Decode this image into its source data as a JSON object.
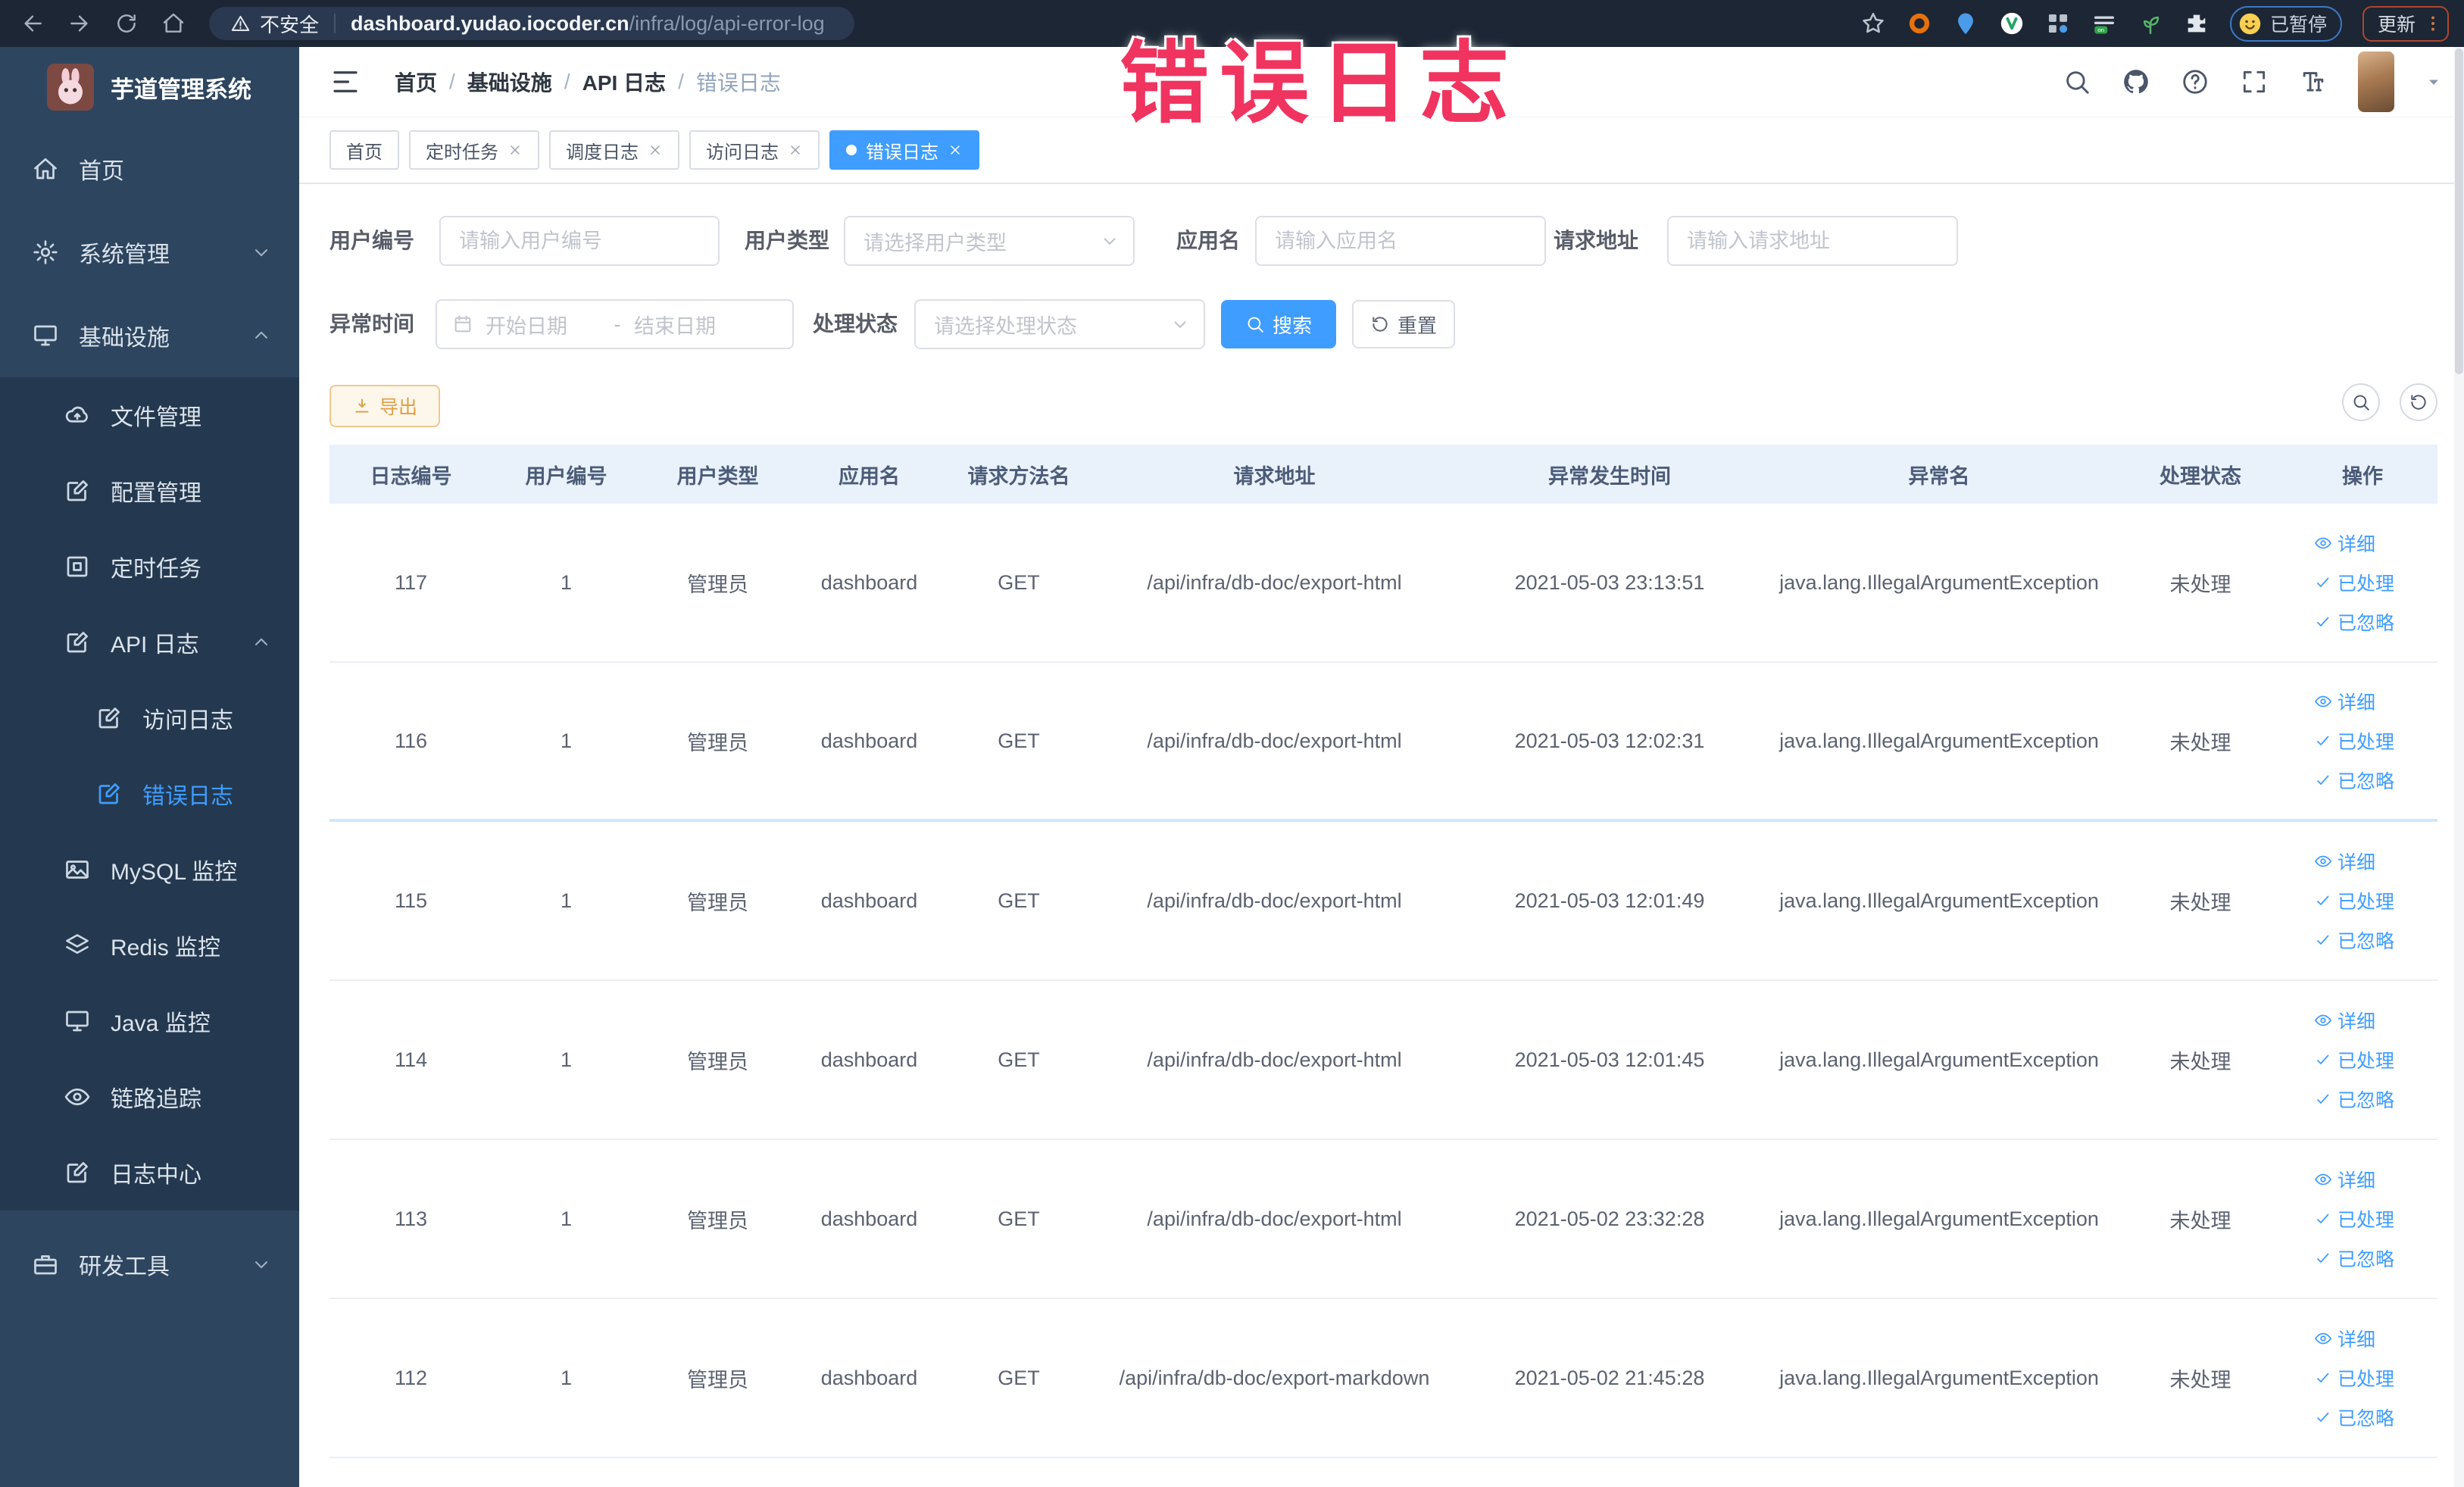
{
  "browser": {
    "nav_icons": [
      "back",
      "forward",
      "reload",
      "home"
    ],
    "security_label": "不安全",
    "url_host": "dashboard.yudao.iocoder.cn",
    "url_path": "/infra/log/api-error-log",
    "toolbar_icons": [
      "star",
      "ring",
      "pin",
      "vcircle",
      "griddots",
      "lineson",
      "sprout",
      "puzzle"
    ],
    "extension_badge": "on",
    "profile_status": "已暂停",
    "update_button": "更新"
  },
  "annotation": {
    "text": "错误日志",
    "color": "#f0345f"
  },
  "sidebar": {
    "title": "芋道管理系统",
    "menu": [
      {
        "label": "首页",
        "icon": "house",
        "level": 0
      },
      {
        "label": "系统管理",
        "icon": "gear",
        "level": 0,
        "chevron": "down"
      },
      {
        "label": "基础设施",
        "icon": "monitor",
        "level": 0,
        "chevron": "up"
      },
      {
        "label": "文件管理",
        "icon": "cloud",
        "level": 1,
        "group": "sub"
      },
      {
        "label": "配置管理",
        "icon": "edit",
        "level": 1,
        "group": "sub"
      },
      {
        "label": "定时任务",
        "icon": "job",
        "level": 1,
        "group": "sub"
      },
      {
        "label": "API 日志",
        "icon": "edit",
        "level": 1,
        "group": "sub",
        "chevron": "up"
      },
      {
        "label": "访问日志",
        "icon": "edit",
        "level": 2,
        "group": "sub"
      },
      {
        "label": "错误日志",
        "icon": "edit",
        "level": 2,
        "group": "sub",
        "active": true
      },
      {
        "label": "MySQL 监控",
        "icon": "image",
        "level": 1,
        "group": "sub"
      },
      {
        "label": "Redis 监控",
        "icon": "layers",
        "level": 1,
        "group": "sub"
      },
      {
        "label": "Java 监控",
        "icon": "monitor",
        "level": 1,
        "group": "sub"
      },
      {
        "label": "链路追踪",
        "icon": "eye",
        "level": 1,
        "group": "sub"
      },
      {
        "label": "日志中心",
        "icon": "edit",
        "level": 1,
        "group": "sub"
      },
      {
        "label": "研发工具",
        "icon": "briefcase",
        "level": 0,
        "chevron": "down"
      }
    ]
  },
  "header": {
    "breadcrumb": [
      "首页",
      "基础设施",
      "API 日志",
      "错误日志"
    ],
    "separator": "/",
    "icons": [
      "search",
      "github",
      "question",
      "expand",
      "fontsize"
    ]
  },
  "tabs": [
    {
      "label": "首页",
      "closable": false,
      "active": false
    },
    {
      "label": "定时任务",
      "closable": true,
      "active": false
    },
    {
      "label": "调度日志",
      "closable": true,
      "active": false
    },
    {
      "label": "访问日志",
      "closable": true,
      "active": false
    },
    {
      "label": "错误日志",
      "closable": true,
      "active": true
    }
  ],
  "filters": {
    "user_id": {
      "label": "用户编号",
      "placeholder": "请输入用户编号"
    },
    "user_type": {
      "label": "用户类型",
      "placeholder": "请选择用户类型"
    },
    "app_name": {
      "label": "应用名",
      "placeholder": "请输入应用名"
    },
    "request_url": {
      "label": "请求地址",
      "placeholder": "请输入请求地址"
    },
    "exception_time": {
      "label": "异常时间",
      "start_placeholder": "开始日期",
      "separator": "-",
      "end_placeholder": "结束日期"
    },
    "process_status": {
      "label": "处理状态",
      "placeholder": "请选择处理状态"
    },
    "search_button": "搜索",
    "reset_button": "重置"
  },
  "toolbar": {
    "export_button": "导出",
    "icons": [
      "search",
      "refreshL"
    ]
  },
  "table": {
    "columns": [
      "日志编号",
      "用户编号",
      "用户类型",
      "应用名",
      "请求方法名",
      "请求地址",
      "异常发生时间",
      "异常名",
      "处理状态",
      "操作"
    ],
    "actions": [
      "详细",
      "已处理",
      "已忽略"
    ],
    "action_icons": [
      "eye",
      "check",
      "check"
    ],
    "rows": [
      {
        "id": "117",
        "user_id": "1",
        "user_type": "管理员",
        "app": "dashboard",
        "method": "GET",
        "url": "/api/infra/db-doc/export-html",
        "time": "2021-05-03 23:13:51",
        "exception": "java.lang.IllegalArgumentException",
        "status": "未处理"
      },
      {
        "id": "116",
        "user_id": "1",
        "user_type": "管理员",
        "app": "dashboard",
        "method": "GET",
        "url": "/api/infra/db-doc/export-html",
        "time": "2021-05-03 12:02:31",
        "exception": "java.lang.IllegalArgumentException",
        "status": "未处理"
      },
      {
        "id": "115",
        "user_id": "1",
        "user_type": "管理员",
        "app": "dashboard",
        "method": "GET",
        "url": "/api/infra/db-doc/export-html",
        "time": "2021-05-03 12:01:49",
        "exception": "java.lang.IllegalArgumentException",
        "status": "未处理"
      },
      {
        "id": "114",
        "user_id": "1",
        "user_type": "管理员",
        "app": "dashboard",
        "method": "GET",
        "url": "/api/infra/db-doc/export-html",
        "time": "2021-05-03 12:01:45",
        "exception": "java.lang.IllegalArgumentException",
        "status": "未处理"
      },
      {
        "id": "113",
        "user_id": "1",
        "user_type": "管理员",
        "app": "dashboard",
        "method": "GET",
        "url": "/api/infra/db-doc/export-html",
        "time": "2021-05-02 23:32:28",
        "exception": "java.lang.IllegalArgumentException",
        "status": "未处理"
      },
      {
        "id": "112",
        "user_id": "1",
        "user_type": "管理员",
        "app": "dashboard",
        "method": "GET",
        "url": "/api/infra/db-doc/export-markdown",
        "time": "2021-05-02 21:45:28",
        "exception": "java.lang.IllegalArgumentException",
        "status": "未处理"
      }
    ]
  },
  "colors": {
    "accent": "#409eff",
    "warning": "#e6a23c",
    "annotation": "#f0345f",
    "chrome_bg": "#1c2634",
    "sidebar_bg": "#2d455e",
    "submenu_bg": "#24394f",
    "table_header_bg": "#e9f1fb"
  }
}
